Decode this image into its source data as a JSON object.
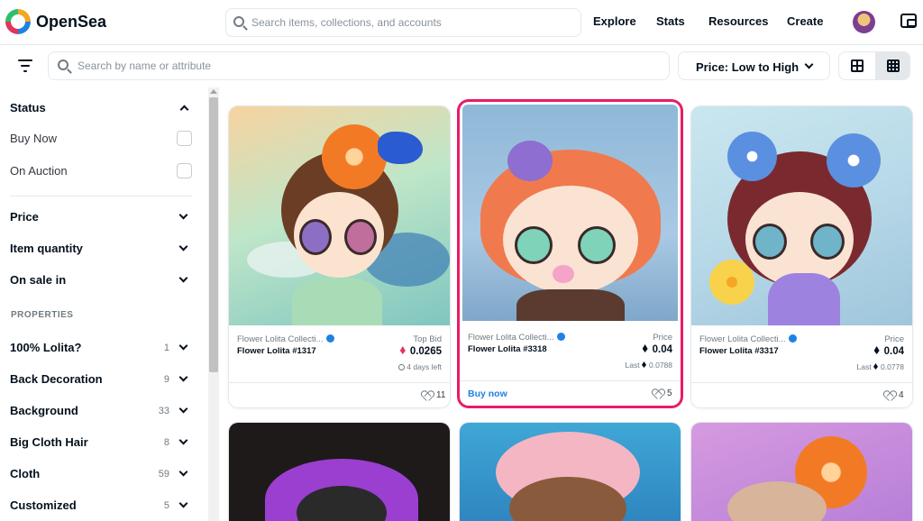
{
  "brand": "OpenSea",
  "top_search_placeholder": "Search items, collections, and accounts",
  "nav": [
    "Explore",
    "Stats",
    "Resources",
    "Create"
  ],
  "filter_search_placeholder": "Search by name or attribute",
  "sort_label": "Price: Low to High",
  "sidebar": {
    "status": {
      "title": "Status",
      "options": [
        "Buy Now",
        "On Auction"
      ]
    },
    "sections": [
      "Price",
      "Item quantity",
      "On sale in"
    ],
    "properties_heading": "PROPERTIES",
    "properties": [
      {
        "label": "100% Lolita?",
        "count": "1"
      },
      {
        "label": "Back Decoration",
        "count": "9"
      },
      {
        "label": "Background",
        "count": "33"
      },
      {
        "label": "Big Cloth Hair",
        "count": "8"
      },
      {
        "label": "Cloth",
        "count": "59"
      },
      {
        "label": "Customized",
        "count": "5"
      }
    ]
  },
  "cards": [
    {
      "collection": "Flower Lolita Collecti...",
      "name": "Flower Lolita #1317",
      "price_label": "Top Bid",
      "price": "0.0265",
      "sub": "4 days left",
      "favorites": "11",
      "buy": ""
    },
    {
      "collection": "Flower Lolita Collecti...",
      "name": "Flower Lolita #3318",
      "price_label": "Price",
      "price": "0.04",
      "sub_label": "Last",
      "sub": "0.0788",
      "favorites": "5",
      "buy": "Buy now"
    },
    {
      "collection": "Flower Lolita Collecti...",
      "name": "Flower Lolita #3317",
      "price_label": "Price",
      "price": "0.04",
      "sub_label": "Last",
      "sub": "0.0778",
      "favorites": "4",
      "buy": ""
    }
  ],
  "colors": {
    "accent": "#2081e2",
    "selected_border": "#e81b67",
    "top_bid_eth": "#e2345c"
  }
}
